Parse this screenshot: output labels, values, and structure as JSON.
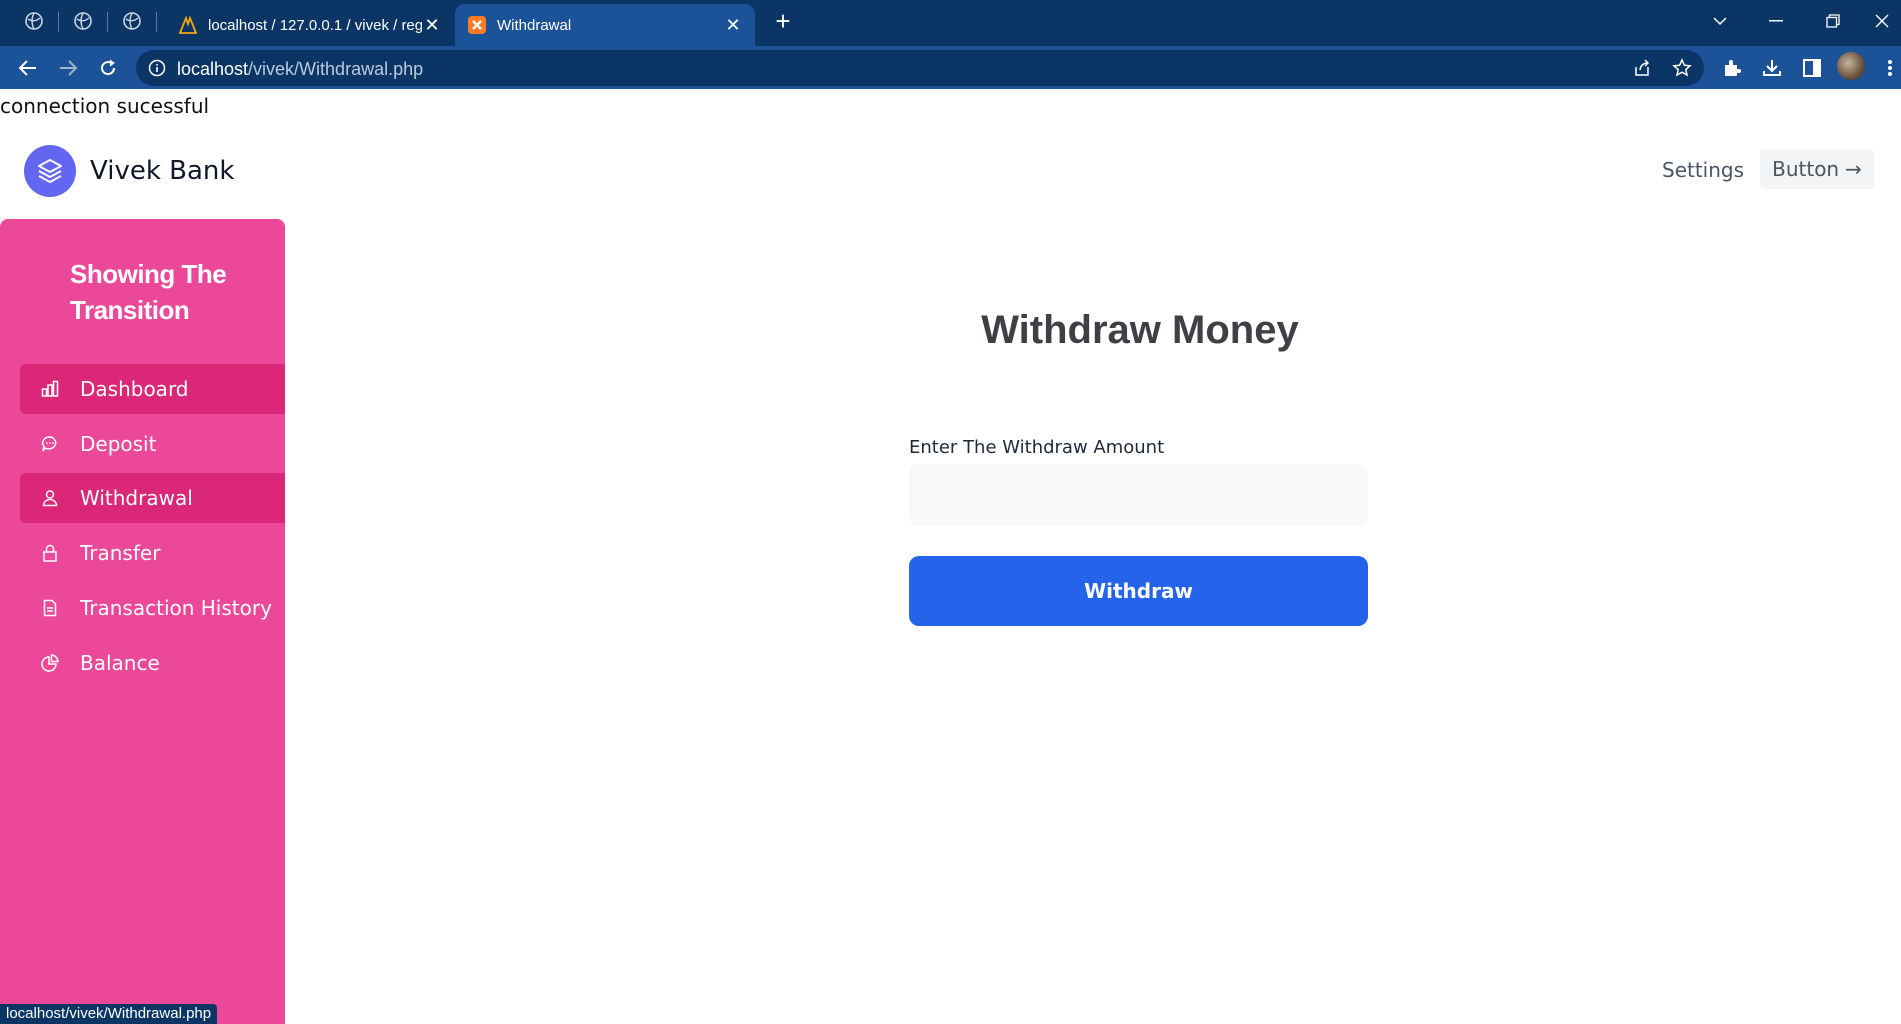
{
  "browser": {
    "tabs": [
      {
        "title": "localhost / 127.0.0.1 / vivek / regi",
        "active": false
      },
      {
        "title": "Withdrawal",
        "active": true
      }
    ],
    "new_tab_label": "+",
    "url_host": "localhost",
    "url_path": "/vivek/Withdrawal.php",
    "status_url": "localhost/vivek/Withdrawal.php"
  },
  "page": {
    "connection_message": "connection sucessful",
    "brand_name": "Vivek Bank",
    "header": {
      "settings_label": "Settings",
      "button_label": "Button",
      "button_arrow": "→"
    },
    "sidebar": {
      "title": "Showing The Transition",
      "items": [
        {
          "label": "Dashboard",
          "icon": "bar-chart-icon",
          "active": true
        },
        {
          "label": "Deposit",
          "icon": "chat-bubble-icon",
          "active": false
        },
        {
          "label": "Withdrawal",
          "icon": "user-icon",
          "active": true
        },
        {
          "label": "Transfer",
          "icon": "lock-icon",
          "active": false
        },
        {
          "label": "Transaction History",
          "icon": "document-icon",
          "active": false
        },
        {
          "label": "Balance",
          "icon": "pie-chart-icon",
          "active": false
        }
      ]
    },
    "form": {
      "heading": "Withdraw Money",
      "amount_label": "Enter The Withdraw Amount",
      "amount_value": "",
      "submit_label": "Withdraw"
    }
  },
  "colors": {
    "sidebar": "#ec4899",
    "sidebar_active": "#db2777",
    "primary_button": "#2563eb",
    "brand_logo": "#6366f1",
    "browser_frame": "#0b3565",
    "browser_toolbar": "#1c5297"
  }
}
